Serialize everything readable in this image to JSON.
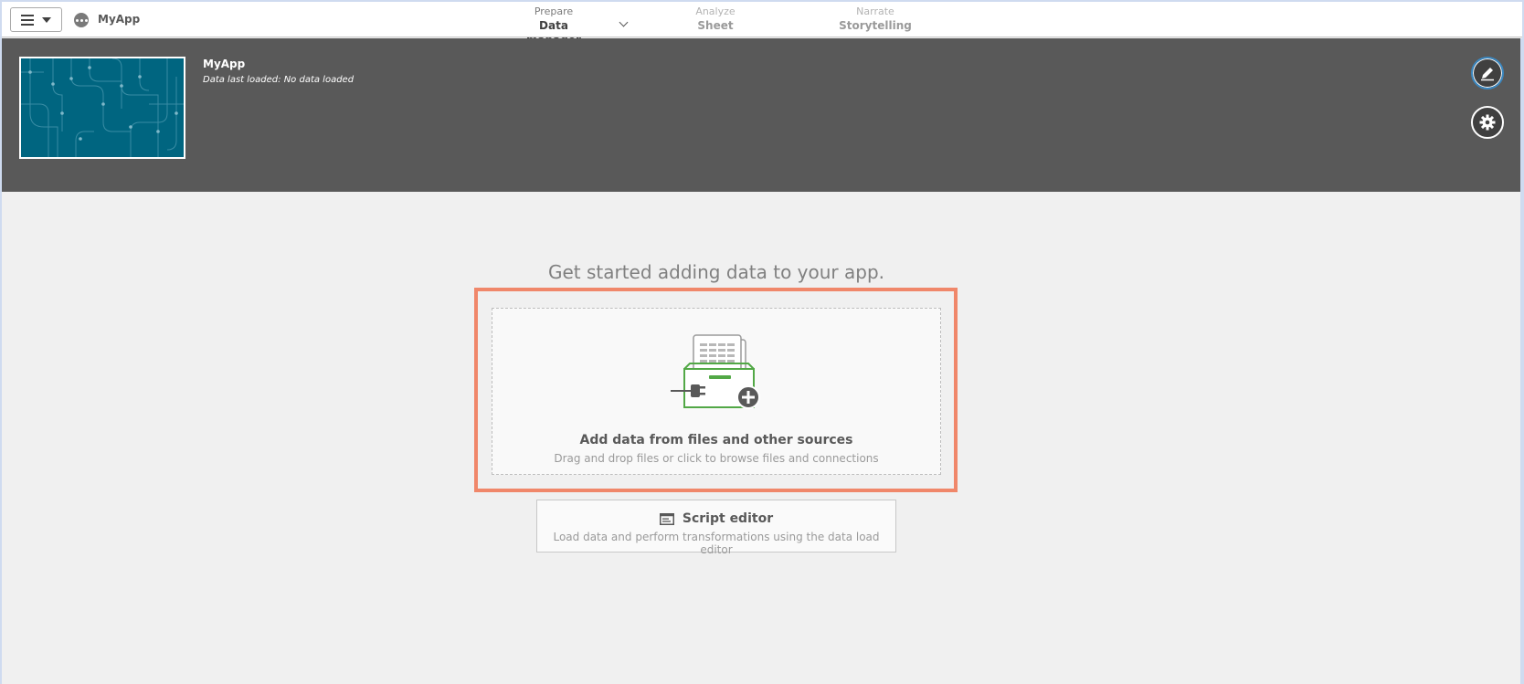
{
  "toolbar": {
    "app_name": "MyApp",
    "nav": [
      {
        "small": "Prepare",
        "label": "Data manager"
      },
      {
        "small": "Analyze",
        "label": "Sheet"
      },
      {
        "small": "Narrate",
        "label": "Storytelling"
      }
    ]
  },
  "header": {
    "title": "MyApp",
    "subtitle": "Data last loaded: No data loaded"
  },
  "main": {
    "title": "Get started adding data to your app.",
    "add_data": {
      "title": "Add data from files and other sources",
      "subtitle": "Drag and drop files or click to browse files and connections"
    },
    "script_editor": {
      "title": "Script editor",
      "subtitle": "Load data and perform transformations using the data load editor"
    }
  },
  "colors": {
    "accent": "#52a846",
    "highlight": "#f0876a",
    "header_bg": "#595959",
    "thumbnail_bg": "#006580"
  },
  "icons": [
    "hamburger-icon",
    "app-options-icon",
    "edit-icon",
    "gear-icon",
    "plug-icon",
    "plus-icon",
    "script-icon"
  ]
}
